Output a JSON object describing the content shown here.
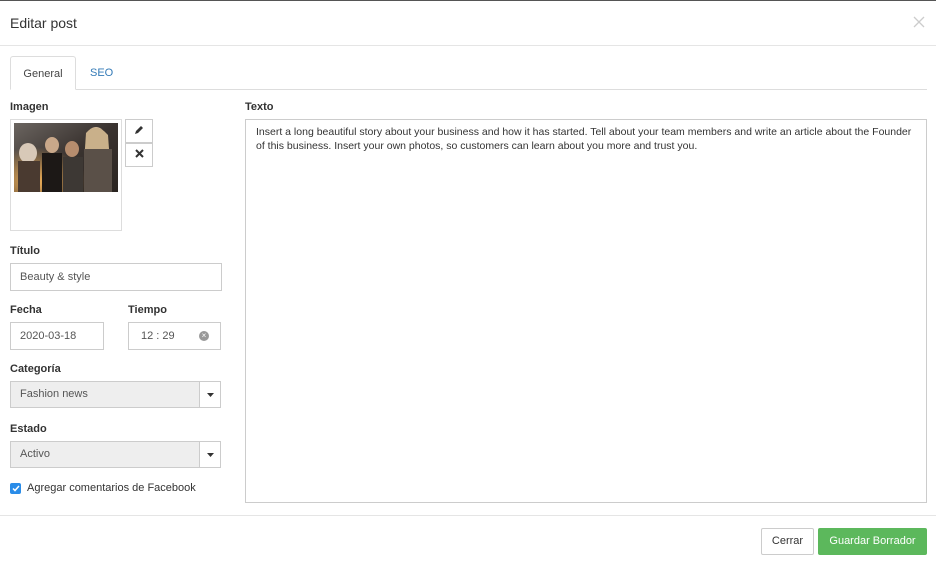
{
  "modal": {
    "title": "Editar post",
    "close_icon": "close-icon"
  },
  "tabs": [
    {
      "label": "General",
      "active": true
    },
    {
      "label": "SEO",
      "active": false
    }
  ],
  "form": {
    "image_label": "Imagen",
    "edit_icon": "pencil-icon",
    "remove_icon": "x-icon",
    "title_label": "Título",
    "title_value": "Beauty & style",
    "date_label": "Fecha",
    "date_value": "2020-03-18",
    "time_label": "Tiempo",
    "time_value": "12 : 29",
    "category_label": "Categoría",
    "category_value": "Fashion news",
    "status_label": "Estado",
    "status_value": "Activo",
    "facebook_label": "Agregar comentarios de Facebook",
    "facebook_checked": true,
    "text_label": "Texto",
    "text_value": "Insert a long beautiful story about your business and how it has started. Tell about your team members and write an article about the Founder of this business. Insert your own photos, so customers can learn about you more and trust you."
  },
  "footer": {
    "cancel_label": "Cerrar",
    "save_label": "Guardar Borrador"
  },
  "colors": {
    "accent": "#337ab7",
    "save": "#5cb85c",
    "checkbox": "#2a8ce8"
  }
}
